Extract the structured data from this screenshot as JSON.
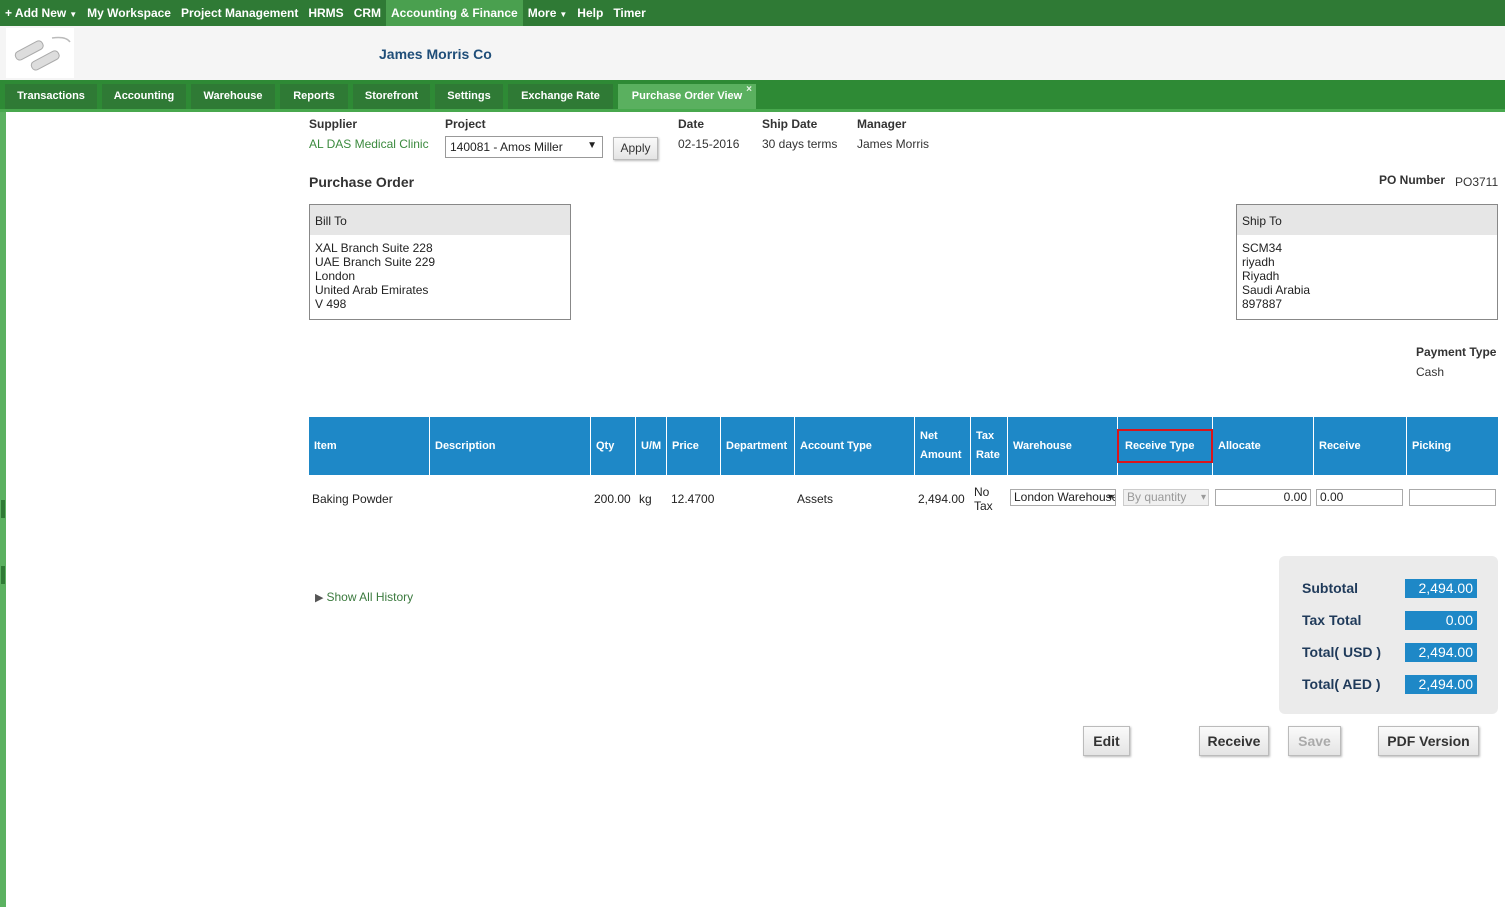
{
  "topnav": {
    "add_new": "+ Add New",
    "items": [
      "My Workspace",
      "Project Management",
      "HRMS",
      "CRM",
      "Accounting & Finance",
      "More",
      "Help",
      "Timer"
    ]
  },
  "header": {
    "company": "James Morris Co"
  },
  "tabs": [
    "Transactions",
    "Accounting",
    "Warehouse",
    "Reports",
    "Storefront",
    "Settings",
    "Exchange Rate",
    "Purchase Order View"
  ],
  "tab_close": "×",
  "info": {
    "supplier_label": "Supplier",
    "supplier": "AL DAS Medical Clinic",
    "project_label": "Project",
    "project": "140081 - Amos Miller",
    "apply": "Apply",
    "date_label": "Date",
    "date": "02-15-2016",
    "ship_date_label": "Ship Date",
    "ship_date": "30 days terms",
    "manager_label": "Manager",
    "manager": "James Morris"
  },
  "po": {
    "title": "Purchase Order",
    "number_label": "PO Number",
    "number": "PO3711"
  },
  "bill_to": {
    "title": "Bill To",
    "lines": [
      "XAL Branch Suite 228",
      "UAE Branch Suite 229",
      "London",
      "United Arab Emirates",
      "V 498"
    ]
  },
  "ship_to": {
    "title": "Ship To",
    "lines": [
      "SCM34",
      "riyadh",
      "Riyadh",
      "Saudi Arabia",
      "897887"
    ]
  },
  "payment": {
    "label": "Payment Type",
    "value": "Cash"
  },
  "table": {
    "headers": [
      "Item",
      "Description",
      "Qty",
      "U/M",
      "Price",
      "Department",
      "Account Type",
      "Net Amount",
      "Tax Rate",
      "Warehouse",
      "Receive Type",
      "Allocate",
      "Receive",
      "Picking"
    ],
    "row": {
      "item": "Baking Powder",
      "description": "",
      "qty": "200.00",
      "um": "kg",
      "price": "12.4700",
      "department": "",
      "account_type": "Assets",
      "net_amount": "2,494.00",
      "tax_rate": "No Tax",
      "warehouse": "London Warehouse",
      "receive_type": "By quantity",
      "allocate": "0.00",
      "receive": "0.00",
      "picking": ""
    }
  },
  "history": "Show All History",
  "totals": {
    "subtotal_label": "Subtotal",
    "subtotal": "2,494.00",
    "tax_label": "Tax Total",
    "tax": "0.00",
    "usd_label": "Total( USD )",
    "usd": "2,494.00",
    "aed_label": "Total( AED )",
    "aed": "2,494.00"
  },
  "actions": {
    "edit": "Edit",
    "receive": "Receive",
    "save": "Save",
    "pdf": "PDF Version"
  },
  "colors": {
    "nav_green": "#2f7a35",
    "header_blue": "#1e88c7",
    "highlight_red": "#d9141a"
  }
}
